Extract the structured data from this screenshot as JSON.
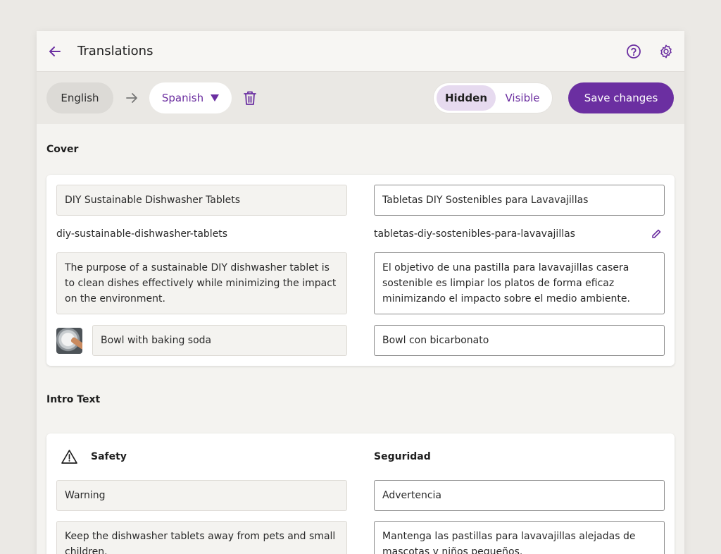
{
  "header": {
    "title": "Translations",
    "back_icon": "arrow-left-icon",
    "help_icon": "help-circle-icon",
    "settings_icon": "gear-icon"
  },
  "toolbar": {
    "source_language": "English",
    "target_language": "Spanish",
    "visibility_options": [
      "Hidden",
      "Visible"
    ],
    "visibility_selected": "Hidden",
    "save_label": "Save changes"
  },
  "colors": {
    "accent": "#6b2fa1",
    "accent_light": "#e6daef",
    "background": "#ebe9e5"
  },
  "cover": {
    "label": "Cover",
    "title_src": "DIY Sustainable Dishwasher Tablets",
    "title_tgt": "Tabletas DIY Sostenibles para Lavavajillas",
    "slug_src": "diy-sustainable-dishwasher-tablets",
    "slug_tgt": "tabletas-diy-sostenibles-para-lavavajillas",
    "desc_src": "The purpose of a sustainable DIY dishwasher tablet is to clean dishes effectively while minimizing the impact on the environment.",
    "desc_tgt": "El objetivo de una pastilla para lavavajillas casera sostenible es limpiar los platos de forma eficaz minimizando el impacto sobre el medio ambiente.",
    "image_caption_src": "Bowl with baking soda",
    "image_caption_tgt": "Bowl con bicarbonato"
  },
  "intro": {
    "label": "Intro Text",
    "heading_src": "Safety",
    "heading_tgt": "Seguridad",
    "warning_src": "Warning",
    "warning_tgt": "Advertencia",
    "body_src": "Keep the dishwasher tablets away from pets and small children.",
    "body_tgt": "Mantenga las pastillas para lavavajillas alejadas de mascotas y niños pequeños."
  }
}
